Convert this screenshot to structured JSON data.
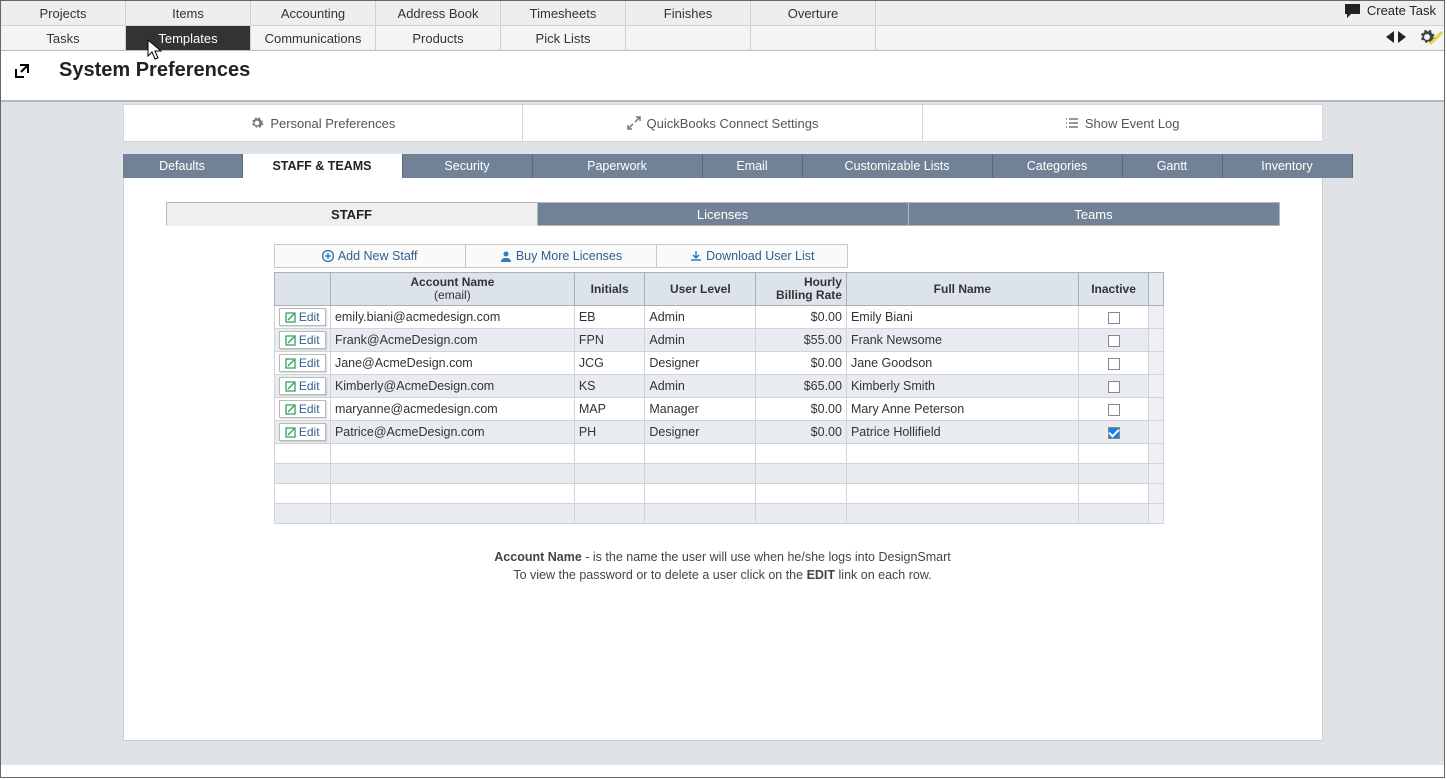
{
  "nav1": [
    "Projects",
    "Items",
    "Accounting",
    "Address Book",
    "Timesheets",
    "Finishes",
    "Overture"
  ],
  "nav2": [
    "Tasks",
    "Templates",
    "Communications",
    "Products",
    "Pick Lists",
    "",
    ""
  ],
  "nav2_active_index": 1,
  "create_task_label": "Create Task",
  "page_title": "System Preferences",
  "top_buttons": {
    "personal": "Personal Preferences",
    "quickbooks": "QuickBooks Connect Settings",
    "eventlog": "Show Event Log"
  },
  "pref_tabs": [
    "Defaults",
    "STAFF & TEAMS",
    "Security",
    "Paperwork",
    "Email",
    "Customizable Lists",
    "Categories",
    "Gantt",
    "Inventory"
  ],
  "pref_tabs_active_index": 1,
  "sub_tabs": [
    "STAFF",
    "Licenses",
    "Teams"
  ],
  "sub_tabs_active_index": 0,
  "actions": {
    "add": "Add New Staff",
    "buy": "Buy More Licenses",
    "download": "Download User List"
  },
  "columns": {
    "edit": "Edit",
    "account": "Account Name",
    "account_sub": "(email)",
    "initials": "Initials",
    "level": "User Level",
    "rate_l1": "Hourly",
    "rate_l2": "Billing Rate",
    "fullname": "Full Name",
    "inactive": "Inactive"
  },
  "staff": [
    {
      "email": "emily.biani@acmedesign.com",
      "initials": "EB",
      "level": "Admin",
      "rate": "$0.00",
      "fullname": "Emily Biani",
      "inactive": false
    },
    {
      "email": "Frank@AcmeDesign.com",
      "initials": "FPN",
      "level": "Admin",
      "rate": "$55.00",
      "fullname": "Frank Newsome",
      "inactive": false
    },
    {
      "email": "Jane@AcmeDesign.com",
      "initials": "JCG",
      "level": "Designer",
      "rate": "$0.00",
      "fullname": "Jane Goodson",
      "inactive": false
    },
    {
      "email": "Kimberly@AcmeDesign.com",
      "initials": "KS",
      "level": "Admin",
      "rate": "$65.00",
      "fullname": "Kimberly Smith",
      "inactive": false
    },
    {
      "email": "maryanne@acmedesign.com",
      "initials": "MAP",
      "level": "Manager",
      "rate": "$0.00",
      "fullname": "Mary Anne Peterson",
      "inactive": false
    },
    {
      "email": "Patrice@AcmeDesign.com",
      "initials": "PH",
      "level": "Designer",
      "rate": "$0.00",
      "fullname": "Patrice Hollifield",
      "inactive": true
    }
  ],
  "help": {
    "line1_bold": "Account Name",
    "line1_rest": " - is the name the user will use when he/she logs into DesignSmart",
    "line2_a": "To view the password or to delete a user click on the ",
    "line2_b": "EDIT",
    "line2_c": " link on each row."
  }
}
